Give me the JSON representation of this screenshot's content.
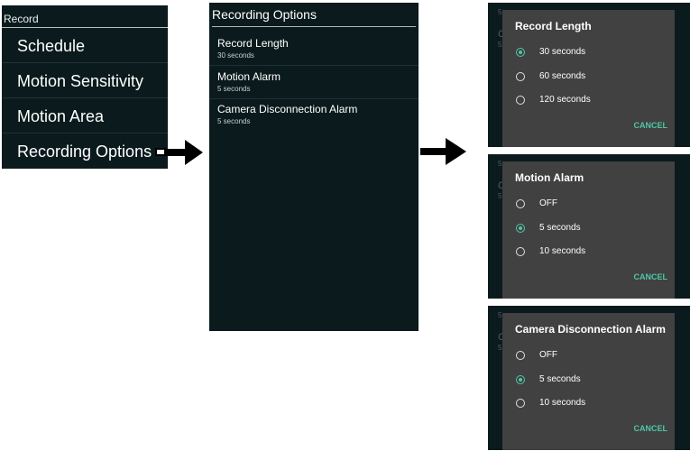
{
  "record_menu": {
    "header": "Record",
    "items": [
      {
        "label": "Schedule"
      },
      {
        "label": "Motion Sensitivity"
      },
      {
        "label": "Motion Area"
      },
      {
        "label": "Recording Options"
      }
    ]
  },
  "recording_options": {
    "title": "Recording Options",
    "options": [
      {
        "label": "Record Length",
        "value": "30 seconds"
      },
      {
        "label": "Motion Alarm",
        "value": "5 seconds"
      },
      {
        "label": "Camera Disconnection Alarm",
        "value": "5 seconds"
      }
    ]
  },
  "dialogs": [
    {
      "title": "Record Length",
      "options": [
        "30 seconds",
        "60 seconds",
        "120 seconds"
      ],
      "selected": "30 seconds",
      "cancel": "CANCEL",
      "background_text": {
        "top": "5",
        "letter": "C",
        "mid": "5"
      }
    },
    {
      "title": "Motion Alarm",
      "options": [
        "OFF",
        "5 seconds",
        "10 seconds"
      ],
      "selected": "5 seconds",
      "cancel": "CANCEL",
      "background_text": {
        "top": "5",
        "letter": "C",
        "mid": "5"
      }
    },
    {
      "title": "Camera Disconnection Alarm",
      "options": [
        "OFF",
        "5 seconds",
        "10 seconds"
      ],
      "selected": "5 seconds",
      "cancel": "CANCEL",
      "background_text": {
        "top": "5",
        "letter": "C",
        "mid": "5"
      }
    }
  ],
  "colors": {
    "panel_bg": "#0b1b1d",
    "dialog_bg": "#414141",
    "accent": "#4fc6a6"
  },
  "icons": [
    "arrow-right-icon",
    "arrow-right-icon"
  ]
}
